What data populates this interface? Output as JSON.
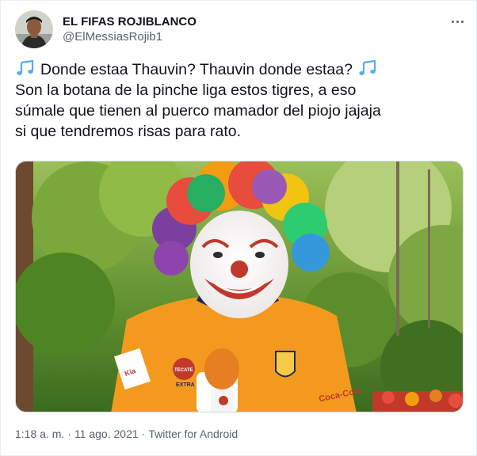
{
  "user": {
    "display_name": "EL FIFAS ROJIBLANCO",
    "handle": "@ElMessiasRojib1"
  },
  "tweet": {
    "line1_text": "Donde estaa Thauvin? Thauvin donde estaa?",
    "line2": "Son la botana de la pinche liga estos tigres, a eso",
    "line3": "súmale que tienen al puerco mamador del piojo jajaja",
    "line4": "si que tendremos risas para rato.",
    "emoji": "musical-notes-icon"
  },
  "media": {
    "jersey_sponsor_1": "TECATE",
    "jersey_sponsor_2": "EXTRA",
    "jersey_sponsor_3": "Coca-Cola"
  },
  "meta": {
    "time": "1:18 a. m.",
    "separator": "·",
    "date": "11 ago. 2021",
    "source": "Twitter for Android"
  },
  "colors": {
    "text": "#0f1419",
    "secondary": "#536471",
    "border": "#e6ecf0",
    "emoji_blue": "#55acee"
  }
}
